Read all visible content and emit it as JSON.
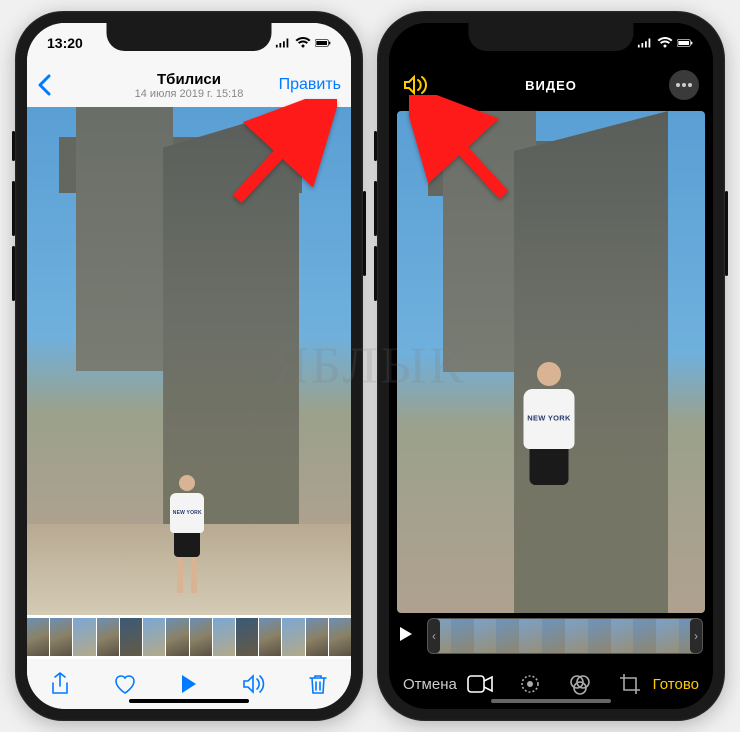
{
  "watermark": "ЯБЛЫК",
  "left": {
    "status": {
      "time": "13:20"
    },
    "nav": {
      "title": "Тбилиси",
      "subtitle": "14 июля 2019 г.  15:18",
      "edit": "Править"
    },
    "shirt": "NEW YORK"
  },
  "right": {
    "title": "ВИДЕО",
    "shirt": "NEW YORK",
    "cancel": "Отмена",
    "done": "Готово"
  }
}
